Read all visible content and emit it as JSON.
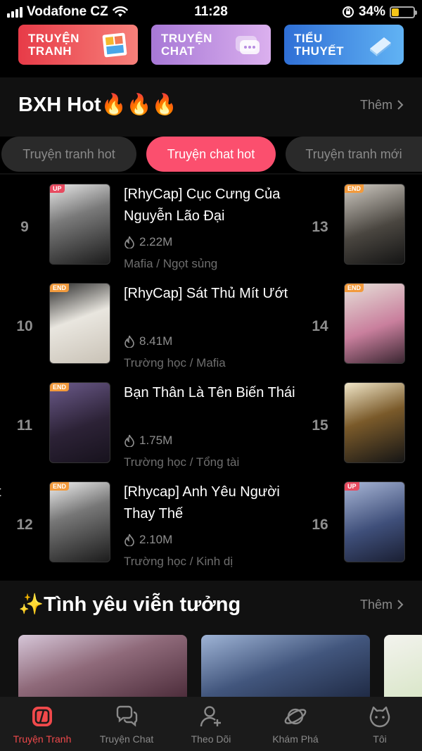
{
  "status_bar": {
    "carrier": "Vodafone CZ",
    "time": "11:28",
    "battery": "34%",
    "battery_level": 0.34
  },
  "categories": [
    {
      "label": "TRUYỆN TRANH",
      "color": "#e73b48"
    },
    {
      "label": "TRUYỆN CHAT",
      "color": "#a778d6"
    },
    {
      "label": "TIỂU THUYẾT",
      "color": "#2f6fd6"
    }
  ],
  "bxh": {
    "title": "BXH Hot🔥🔥🔥",
    "more": "Thêm",
    "tabs": [
      {
        "label": "Truyện tranh hot",
        "active": false
      },
      {
        "label": "Truyện chat hot",
        "active": true
      },
      {
        "label": "Truyện tranh mới",
        "active": false
      }
    ],
    "items": [
      {
        "rank": "9",
        "badge": "UP",
        "title": "[RhyCap] Cục Cưng Của Nguyễn Lão Đại",
        "views": "2.22M",
        "tags": "Mafia / Ngọt sủng"
      },
      {
        "rank": "10",
        "badge": "END",
        "title": "[RhyCap] Sát Thủ Mít Ướt",
        "views": "8.41M",
        "tags": "Trường học / Mafia"
      },
      {
        "rank": "11",
        "badge": "END",
        "title": "Bạn Thân Là Tên Biến Thái",
        "views": "1.75M",
        "tags": "Trường học / Tổng tài"
      },
      {
        "rank": "12",
        "badge": "END",
        "title": "[Rhycap] Anh Yêu Người Thay Thế",
        "views": "2.10M",
        "tags": "Trường học / Kinh dị"
      }
    ],
    "right_items": [
      {
        "rank": "13",
        "badge": "END"
      },
      {
        "rank": "14",
        "badge": "END"
      },
      {
        "rank": "15",
        "badge": ""
      },
      {
        "rank": "16",
        "badge": "UP"
      }
    ]
  },
  "love": {
    "title": "✨Tình yêu viễn tưởng",
    "more": "Thêm"
  },
  "tabbar": [
    {
      "label": "Truyện Tranh",
      "icon": "comic-icon",
      "active": true
    },
    {
      "label": "Truyện Chat",
      "icon": "chat-icon",
      "active": false
    },
    {
      "label": "Theo Dõi",
      "icon": "follow-user-icon",
      "active": false
    },
    {
      "label": "Khám Phá",
      "icon": "planet-icon",
      "active": false
    },
    {
      "label": "Tôi",
      "icon": "profile-face-icon",
      "active": false
    }
  ]
}
